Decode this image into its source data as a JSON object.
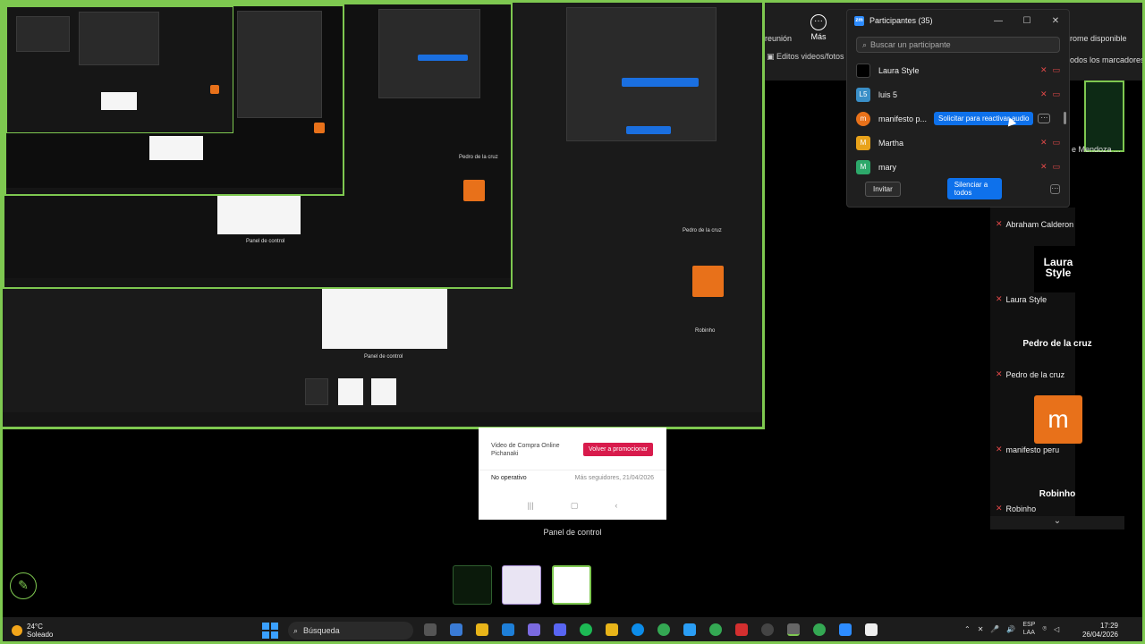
{
  "participants_panel": {
    "title": "Participantes (35)",
    "search_placeholder": "Buscar un participante",
    "rows": [
      {
        "name": "Laura Style",
        "initials": "",
        "color": "#000000",
        "request": ""
      },
      {
        "name": "luis 5",
        "initials": "L5",
        "color": "#3a8fc7",
        "request": ""
      },
      {
        "name": "manifesto p...",
        "initials": "m",
        "color": "#e8711a",
        "request": "Solicitar para reactivar audio"
      },
      {
        "name": "Martha",
        "initials": "M",
        "color": "#e8a21a",
        "request": ""
      },
      {
        "name": "mary",
        "initials": "M",
        "color": "#2da86a",
        "request": ""
      }
    ],
    "invite_label": "Invitar",
    "mute_all_label": "Silenciar a todos",
    "more_label": "···"
  },
  "meeting_toolbar": {
    "reunion_label": "reunión",
    "more_label": "Más",
    "editos_label": "Editos videos/fotos"
  },
  "side_texts": {
    "chrome_available": "rome disponible",
    "all_bookmarks": "odos los marcadores",
    "mendoza": "e Mendoza ..."
  },
  "video_list": {
    "abraham": "Abraham Calderon",
    "laura_logo_line1": "Laura",
    "laura_logo_line2": "Style",
    "laura": "Laura Style",
    "pedro_center": "Pedro de la cruz",
    "pedro": "Pedro de la cruz",
    "m_letter": "m",
    "manifesto": "manifesto peru",
    "robinho_center": "Robinho",
    "robinho": "Robinho"
  },
  "phone_preview": {
    "video_text": "Video de Compra Online Pichanaki",
    "promote_button": "Volver a promocionar",
    "status": "No operativo",
    "date": "Más seguidores, 21/04/2026",
    "panel_label": "Panel de control"
  },
  "taskbar": {
    "temperature": "24°C",
    "weather": "Soleado",
    "search": "Búsqueda",
    "lang_line1": "ESP",
    "lang_line2": "LAA",
    "time": "17:29",
    "date": "26/04/2026"
  }
}
